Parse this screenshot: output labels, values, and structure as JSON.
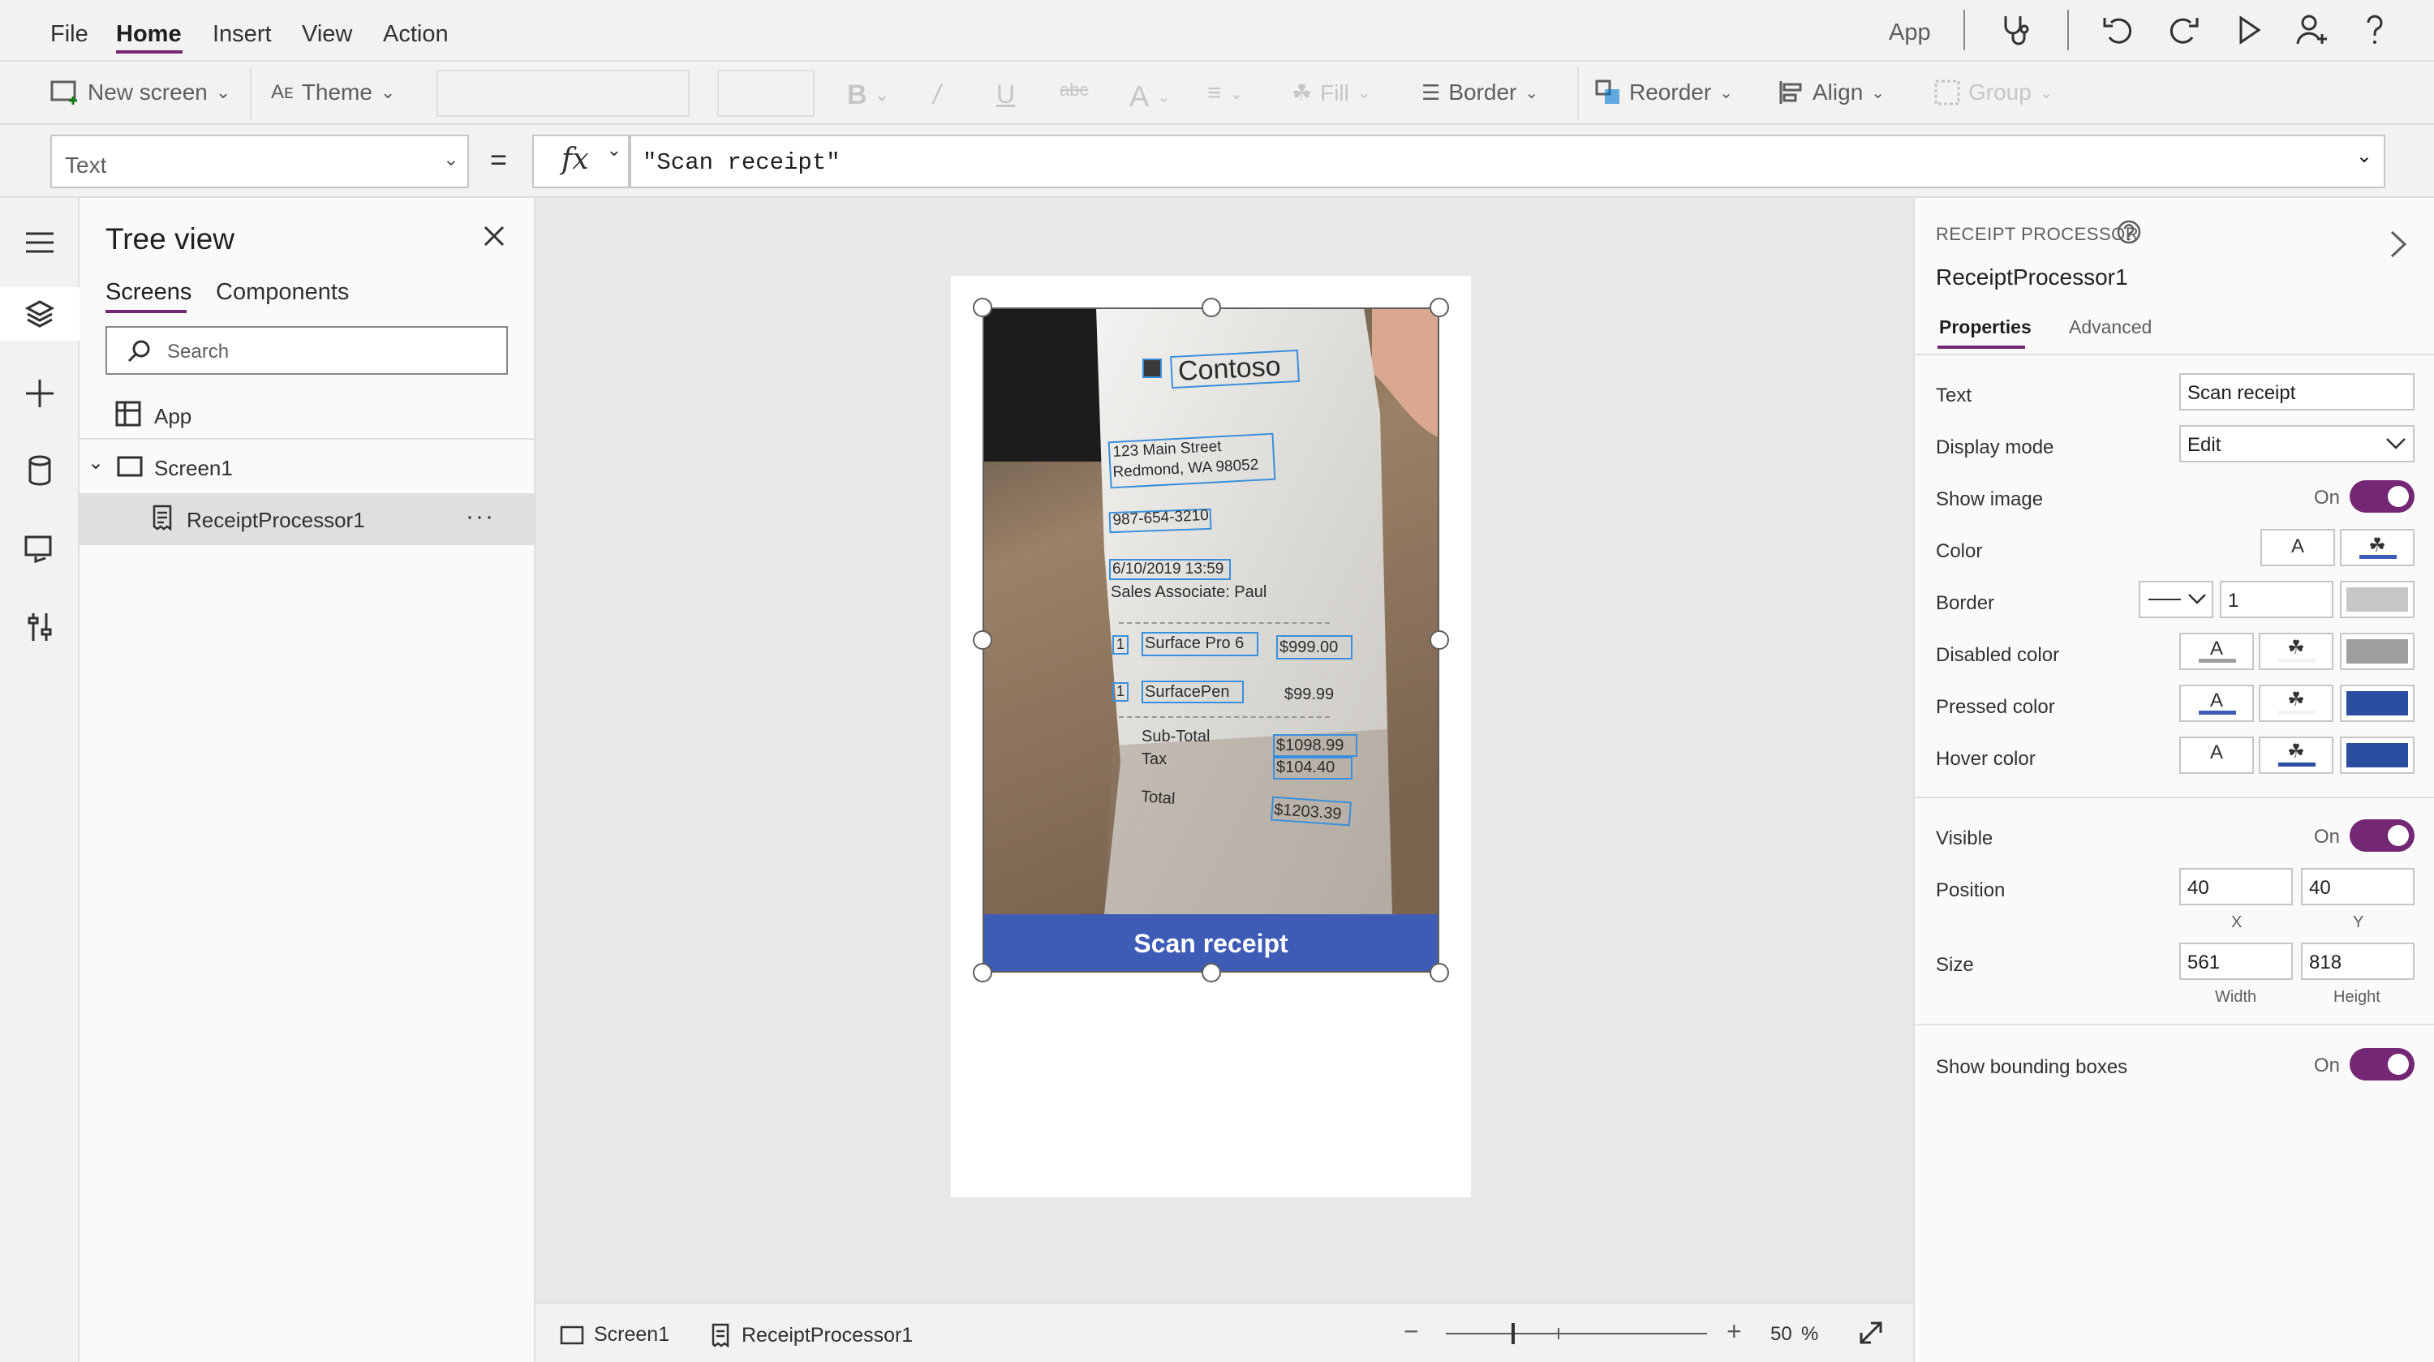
{
  "menu": {
    "file": "File",
    "home": "Home",
    "insert": "Insert",
    "view": "View",
    "action": "Action",
    "app_label": "App"
  },
  "ribbon": {
    "new_screen": "New screen",
    "theme": "Theme",
    "fill": "Fill",
    "border": "Border",
    "reorder": "Reorder",
    "align": "Align",
    "group": "Group"
  },
  "formula": {
    "property": "Text",
    "equals": "=",
    "fx": "fx",
    "value": "\"Scan receipt\""
  },
  "tree": {
    "title": "Tree view",
    "tabs": [
      "Screens",
      "Components"
    ],
    "search_placeholder": "Search",
    "items": [
      {
        "label": "App"
      },
      {
        "label": "Screen1"
      },
      {
        "label": "ReceiptProcessor1"
      }
    ],
    "more": "···"
  },
  "canvas": {
    "button_text": "Scan receipt",
    "receipt_text": {
      "brand": "Contoso",
      "address1": "123 Main Street",
      "address2": "Redmond, WA 98052",
      "phone": "987-654-3210",
      "date": "6/10/2019 13:59",
      "associate": "Sales Associate: Paul",
      "qty1": "1",
      "item1": "Surface Pro 6",
      "price1": "$999.00",
      "qty2": "1",
      "item2": "SurfacePen",
      "price2": "$99.99",
      "subtotal_label": "Sub-Total",
      "tax_label": "Tax",
      "subtotal": "$1098.99",
      "tax": "$104.40",
      "total_label": "Total",
      "total": "$1203.39"
    }
  },
  "status": {
    "screen": "Screen1",
    "control": "ReceiptProcessor1",
    "zoom": "50",
    "zoom_unit": "%"
  },
  "properties": {
    "control_type": "RECEIPT PROCESSOR",
    "control_name": "ReceiptProcessor1",
    "tabs": [
      "Properties",
      "Advanced"
    ],
    "text_label": "Text",
    "text_value": "Scan receipt",
    "display_mode_label": "Display mode",
    "display_mode_value": "Edit",
    "show_image_label": "Show image",
    "show_image_value": "On",
    "color_label": "Color",
    "border_label": "Border",
    "border_width": "1",
    "disabled_color_label": "Disabled color",
    "pressed_color_label": "Pressed color",
    "hover_color_label": "Hover color",
    "swatch_text": "A",
    "visible_label": "Visible",
    "visible_value": "On",
    "position_label": "Position",
    "position_x": "40",
    "position_y": "40",
    "x_label": "X",
    "y_label": "Y",
    "size_label": "Size",
    "width": "561",
    "height": "818",
    "width_label": "Width",
    "height_label": "Height",
    "show_bbox_label": "Show bounding boxes",
    "show_bbox_value": "On"
  },
  "colors": {
    "accent": "#742774",
    "button": "#3e5cb5",
    "pressed": "#2b4fa0",
    "disabled": "#a19f9d"
  }
}
